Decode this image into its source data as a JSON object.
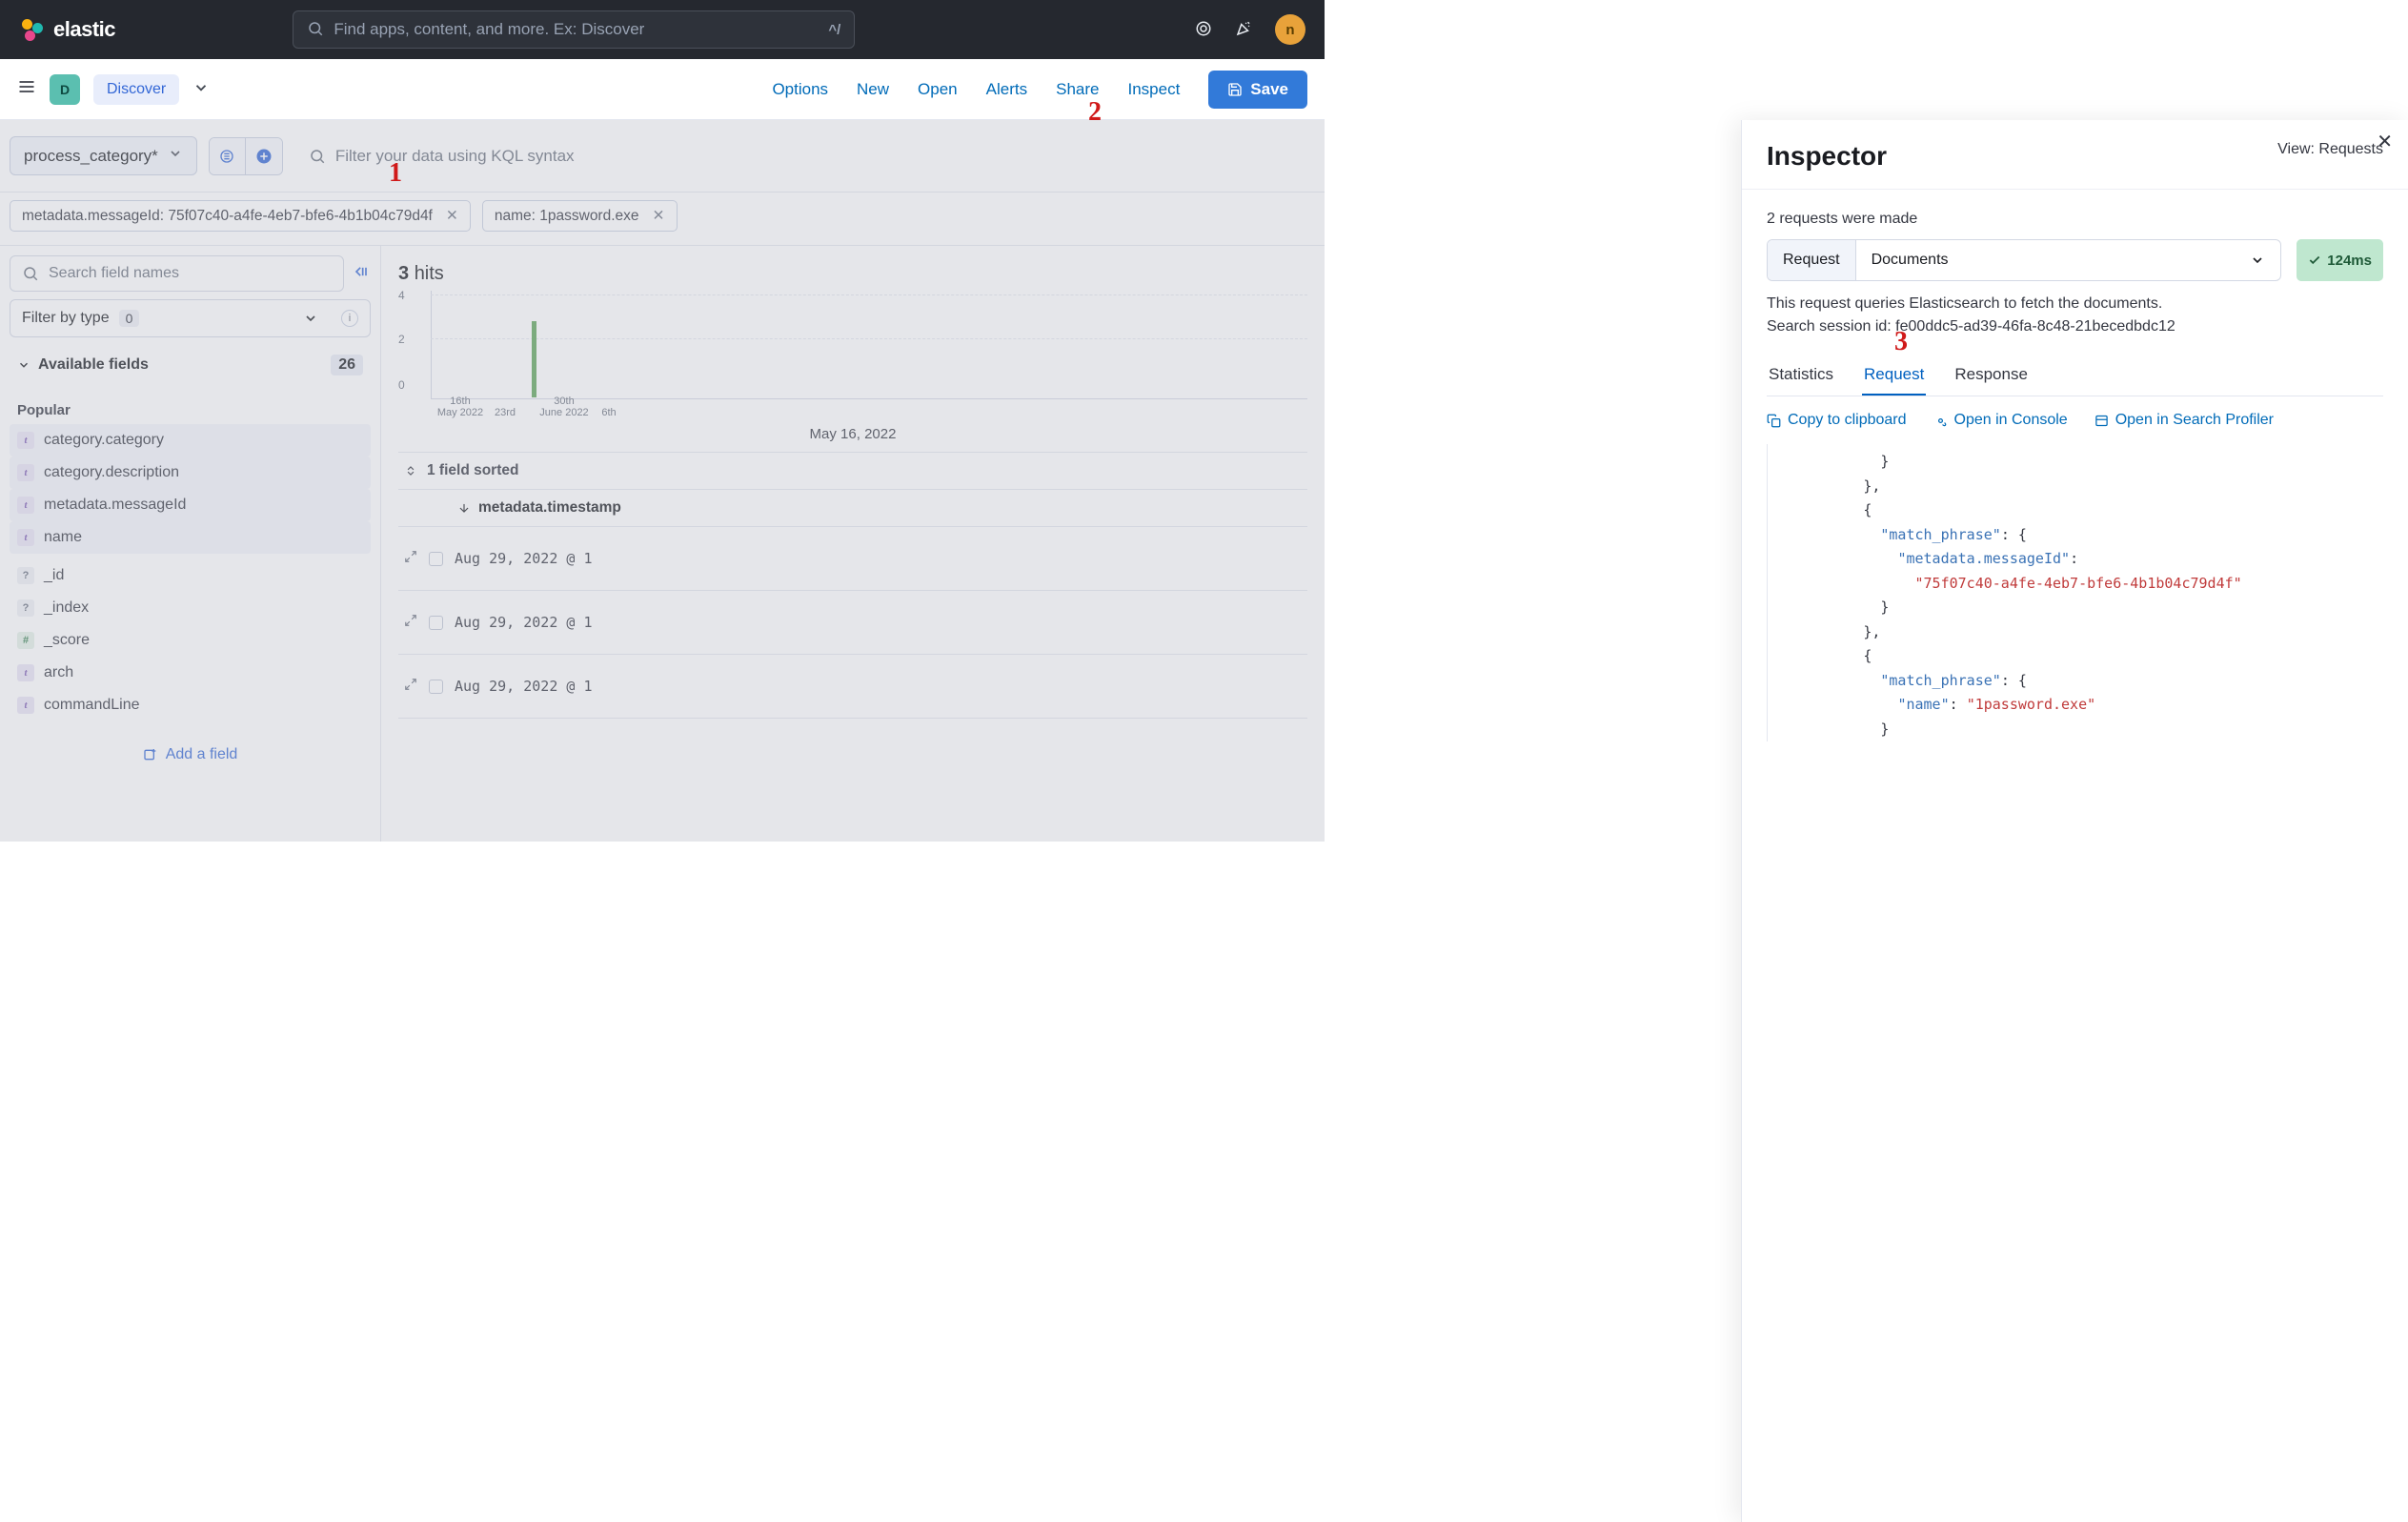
{
  "topbar": {
    "brand": "elastic",
    "search_placeholder": "Find apps, content, and more. Ex: Discover",
    "kbd_hint": "^/",
    "avatar_initial": "n"
  },
  "subheader": {
    "nav_badge": "D",
    "nav_chip": "Discover",
    "actions": {
      "options": "Options",
      "new": "New",
      "open": "Open",
      "alerts": "Alerts",
      "share": "Share",
      "inspect": "Inspect",
      "save": "Save"
    }
  },
  "annotations": {
    "a1": "1",
    "a2": "2",
    "a3": "3"
  },
  "filters": {
    "data_view": "process_category*",
    "kql_placeholder": "Filter your data using KQL syntax",
    "chips": [
      "metadata.messageId: 75f07c40-a4fe-4eb7-bfe6-4b1b04c79d4f",
      "name: 1password.exe"
    ]
  },
  "sidebar": {
    "search_placeholder": "Search field names",
    "filter_label": "Filter by type",
    "filter_count": "0",
    "section_label": "Available fields",
    "section_count": "26",
    "group_popular": "Popular",
    "add_field": "Add a field",
    "popular": [
      {
        "name": "category.category",
        "type": "t"
      },
      {
        "name": "category.description",
        "type": "t"
      },
      {
        "name": "metadata.messageId",
        "type": "t"
      },
      {
        "name": "name",
        "type": "t"
      }
    ],
    "others": [
      {
        "name": "_id",
        "type": "q"
      },
      {
        "name": "_index",
        "type": "q"
      },
      {
        "name": "_score",
        "type": "h"
      },
      {
        "name": "arch",
        "type": "t"
      },
      {
        "name": "commandLine",
        "type": "t"
      }
    ]
  },
  "results": {
    "hits_count": "3",
    "hits_label": "hits",
    "date_range_label": "May 16, 2022",
    "sort_label": "1 field sorted",
    "col_header": "metadata.timestamp",
    "rows": [
      "Aug 29, 2022 @ 1",
      "Aug 29, 2022 @ 1",
      "Aug 29, 2022 @ 1"
    ]
  },
  "chart_data": {
    "type": "bar",
    "y_ticks": [
      "0",
      "2",
      "4"
    ],
    "x_ticks": [
      {
        "top": "16th",
        "bottom": "May 2022"
      },
      {
        "top": "23rd",
        "bottom": ""
      },
      {
        "top": "30th",
        "bottom": "June 2022"
      },
      {
        "top": "6th",
        "bottom": ""
      }
    ],
    "ylim": [
      0,
      4
    ]
  },
  "inspector": {
    "title": "Inspector",
    "view_label": "View: Requests",
    "summary": "2 requests were made",
    "combo_label": "Request",
    "combo_value": "Documents",
    "timing": "124ms",
    "description_line1": "This request queries Elasticsearch to fetch the documents.",
    "description_line2": "Search session id: fe00ddc5-ad39-46fa-8c48-21becedbdc12",
    "tabs": {
      "stats": "Statistics",
      "request": "Request",
      "response": "Response"
    },
    "actions": {
      "copy": "Copy to clipboard",
      "console": "Open in Console",
      "profiler": "Open in Search Profiler"
    },
    "code": {
      "mp": "\"match_phrase\"",
      "k_msg": "\"metadata.messageId\"",
      "v_msg": "\"75f07c40-a4fe-4eb7-bfe6-4b1b04c79d4f\"",
      "k_name": "\"name\"",
      "v_name": "\"1password.exe\""
    }
  }
}
